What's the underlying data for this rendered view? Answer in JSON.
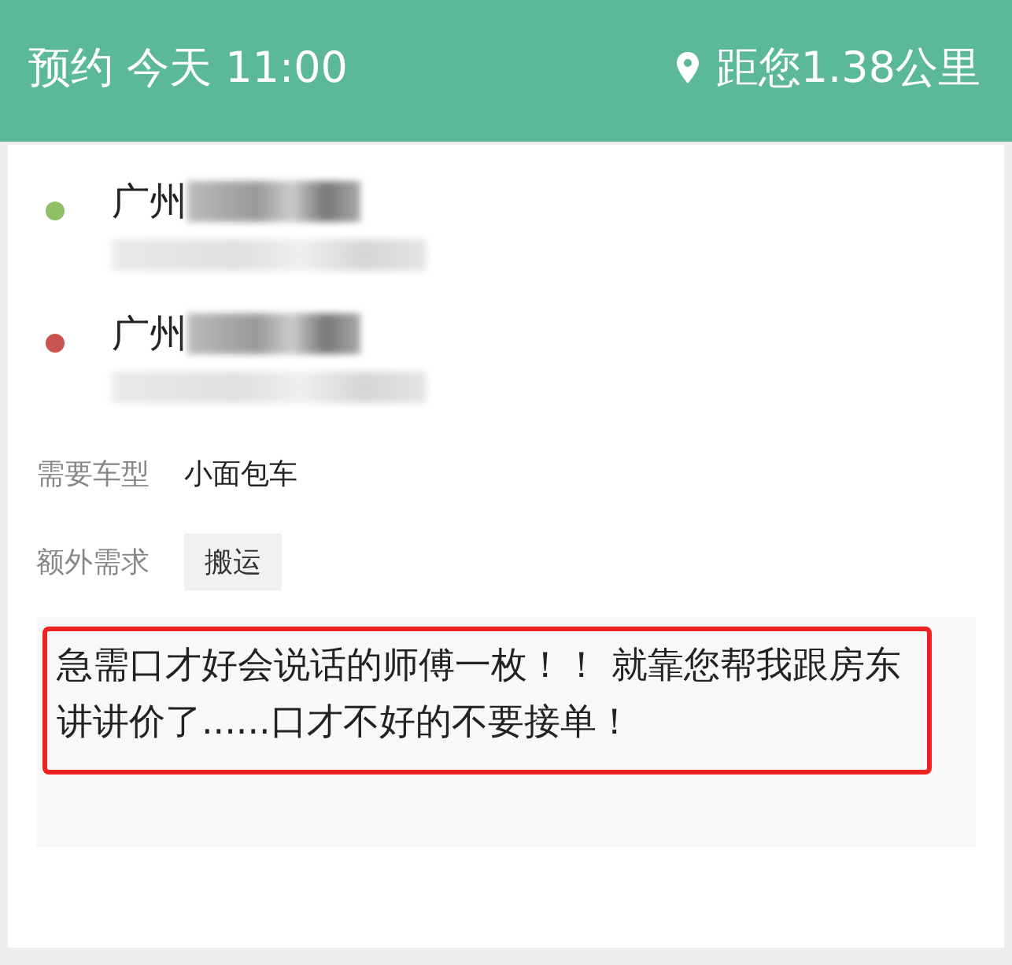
{
  "header": {
    "title": "预约 今天 11:00",
    "distance": "距您1.38公里"
  },
  "stops": [
    {
      "city": "广州",
      "color": "#8fc066"
    },
    {
      "city": "广州",
      "color": "#c9544f"
    }
  ],
  "details": [
    {
      "kind": "text",
      "label": "需要车型",
      "value": "小面包车"
    },
    {
      "kind": "tag",
      "label": "额外需求",
      "value": "搬运"
    }
  ],
  "note": {
    "text": "急需口才好会说话的师傅一枚！！ 就靠您帮我跟房东讲讲价了......口才不好的不要接单！",
    "highlighted": true
  }
}
